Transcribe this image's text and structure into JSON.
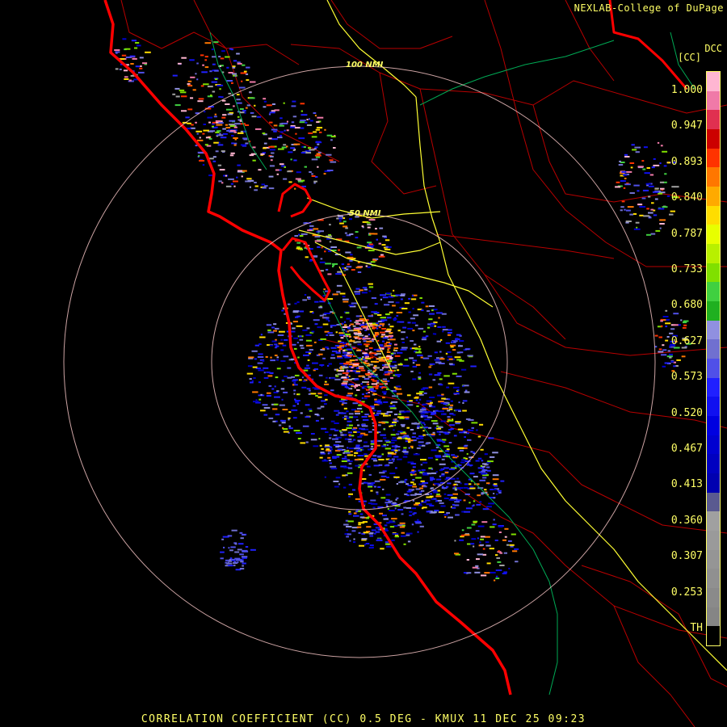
{
  "credit": "NEXLAB-College of DuPage",
  "product_code": "DCC",
  "units_label": "[CC]",
  "title": "CORRELATION COEFFICIENT (CC) 0.5 DEG - KMUX 11 DEC 25 09:23",
  "range_rings": [
    {
      "label": "100 NMI"
    },
    {
      "label": "50 NMI"
    }
  ],
  "color_scale": {
    "ticks": [
      "1.000",
      "0.947",
      "0.893",
      "0.840",
      "0.787",
      "0.733",
      "0.680",
      "0.627",
      "0.573",
      "0.520",
      "0.467",
      "0.413",
      "0.360",
      "0.307",
      "0.253",
      "TH"
    ],
    "colors": [
      "#ffb6d2",
      "#f07aa8",
      "#e03050",
      "#cc0000",
      "#ff3300",
      "#ff7700",
      "#ffaa00",
      "#ffdd00",
      "#e8ff00",
      "#b8f000",
      "#80e000",
      "#40d040",
      "#20b020",
      "#9090e0",
      "#7070d0",
      "#5050e8",
      "#2020ff",
      "#1010f0",
      "#0000e0",
      "#0000d0",
      "#0000c0",
      "#0000b0",
      "#5a5a90",
      "#a0a0a0",
      "#9a9a9a",
      "#959595",
      "#909090",
      "#8a8a8a",
      "#858585",
      "#000000"
    ]
  },
  "colors": {
    "coast": "#ff0000",
    "county": "#b80000",
    "highway": "#ffff33",
    "water": "#00aa55",
    "ring": "#ffcccc"
  }
}
